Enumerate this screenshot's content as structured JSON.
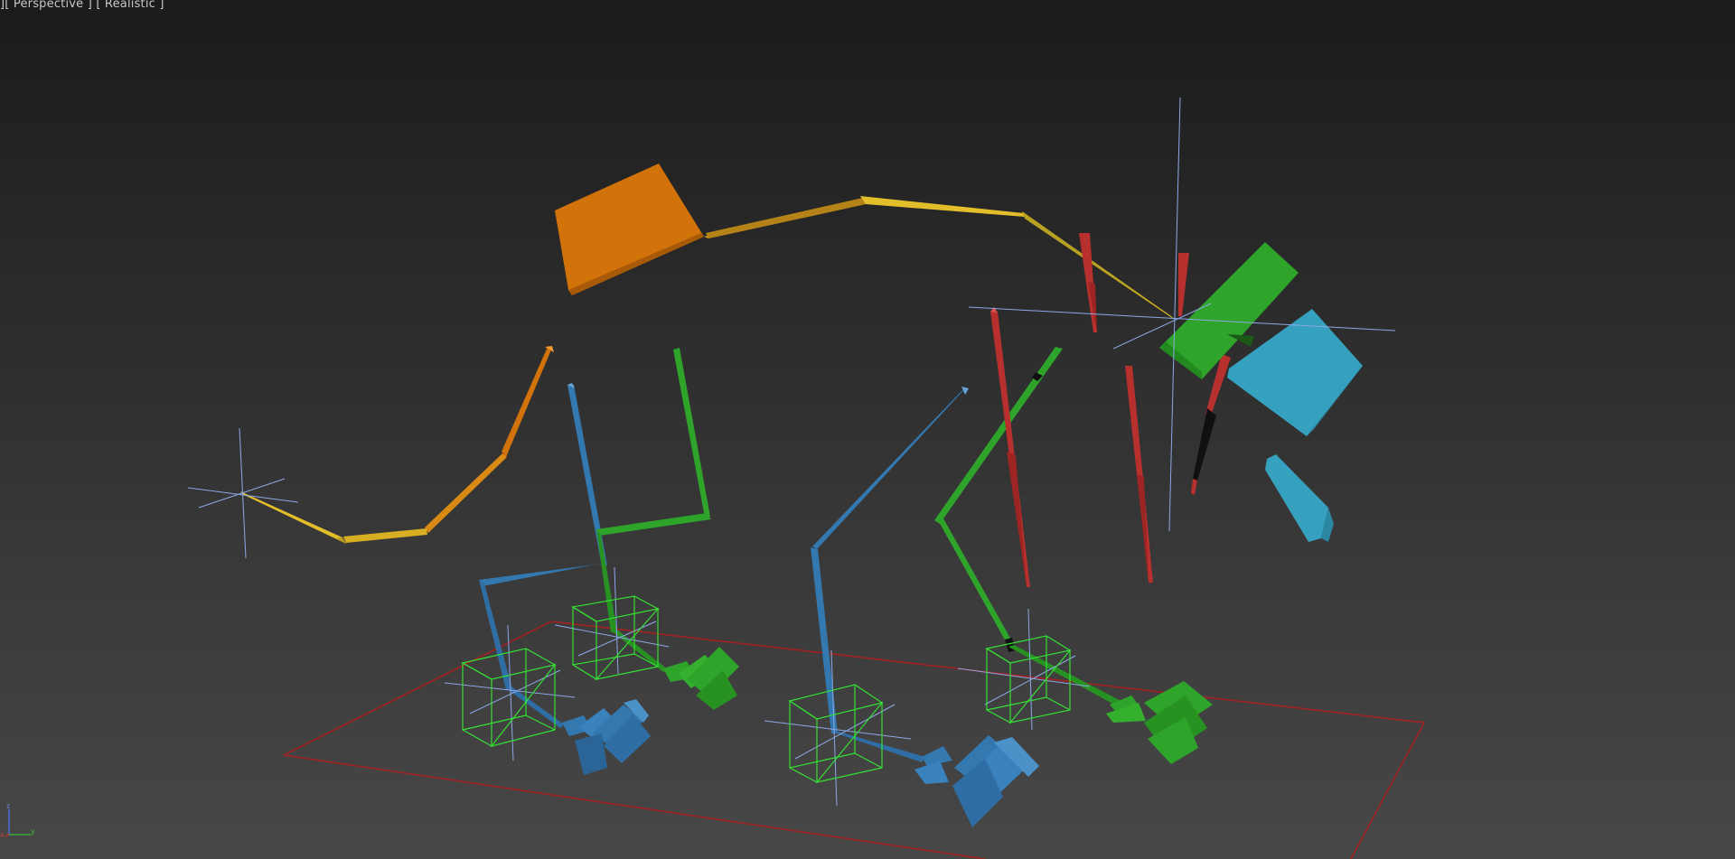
{
  "viewport": {
    "label_prefix": "]",
    "view_name": "[ Perspective ]",
    "shading_mode": "[ Realistic ]"
  },
  "axis_gizmo": {
    "z_label": "z",
    "y_label": "y",
    "x_label": "x"
  },
  "colors": {
    "bone_yellow": "#e2be2a",
    "bone_orange": "#d1720a",
    "bone_blue": "#3478b0",
    "bone_green": "#2ea42a",
    "bone_red": "#b8302e",
    "bone_cyan": "#36a0bf",
    "helper_cross": "#8da8e6",
    "selection_box": "#35e035",
    "ground_outline": "#a82020"
  }
}
